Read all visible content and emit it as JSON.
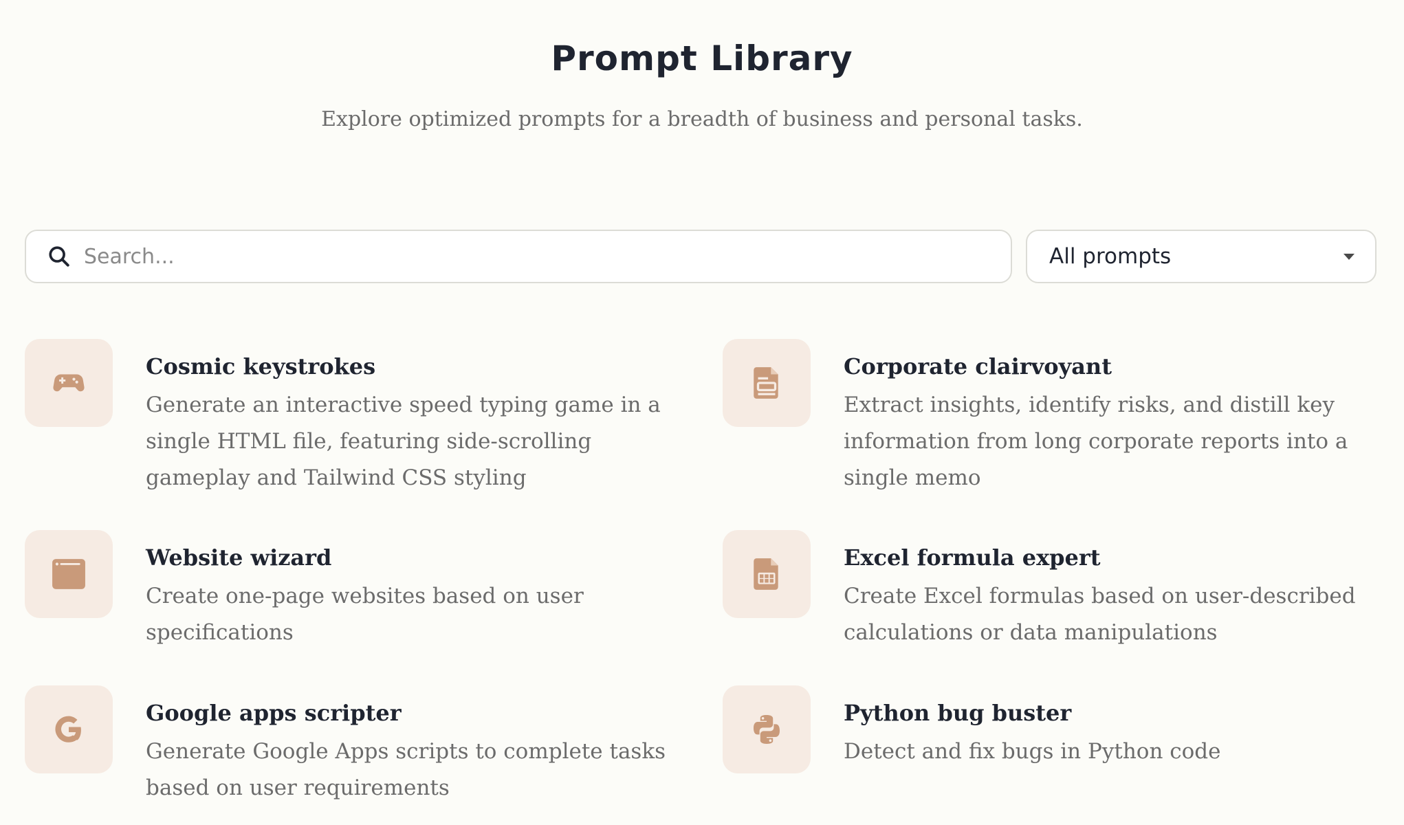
{
  "header": {
    "title": "Prompt Library",
    "subtitle": "Explore optimized prompts for a breadth of business and personal tasks."
  },
  "search": {
    "placeholder": "Search...",
    "value": "",
    "icon": "search-icon"
  },
  "filter": {
    "selected": "All prompts",
    "icon": "chevron-down-icon"
  },
  "colors": {
    "background": "#fcfcf8",
    "icon_tile": "#f6ebe3",
    "icon_accent": "#c99a7a",
    "title_text": "#1f2430",
    "body_text": "#6b6b6b"
  },
  "prompts": [
    {
      "title": "Cosmic keystrokes",
      "description": "Generate an interactive speed typing game in a single HTML file, featuring side-scrolling gameplay and Tailwind CSS styling",
      "icon": "gamepad-icon"
    },
    {
      "title": "Corporate clairvoyant",
      "description": "Extract insights, identify risks, and distill key information from long corporate reports into a single memo",
      "icon": "document-icon"
    },
    {
      "title": "Website wizard",
      "description": "Create one-page websites based on user specifications",
      "icon": "browser-window-icon"
    },
    {
      "title": "Excel formula expert",
      "description": "Create Excel formulas based on user-described calculations or data manipulations",
      "icon": "spreadsheet-file-icon"
    },
    {
      "title": "Google apps scripter",
      "description": "Generate Google Apps scripts to complete tasks based on user requirements",
      "icon": "google-icon"
    },
    {
      "title": "Python bug buster",
      "description": "Detect and fix bugs in Python code",
      "icon": "python-icon"
    }
  ]
}
